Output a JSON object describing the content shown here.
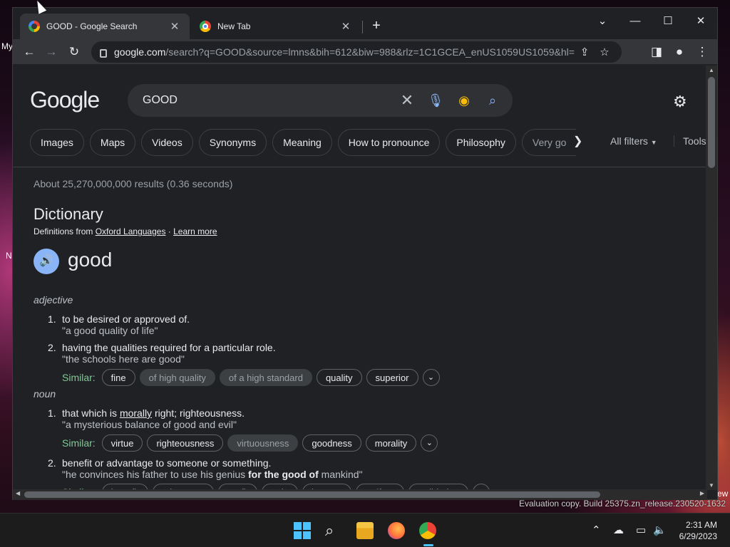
{
  "desktop": {
    "icon_label_1": "My",
    "icon_label_2": "N",
    "icon_label_3": "ew",
    "watermark": "Evaluation copy. Build 25375.zn_release.230520-1632"
  },
  "tabs": [
    {
      "title": "GOOD - Google Search"
    },
    {
      "title": "New Tab"
    }
  ],
  "toolbar": {
    "url_host": "google.com",
    "url_path": "/search?q=GOOD&source=lmns&bih=612&biw=988&rlz=1C1GCEA_enUS1059US1059&hl=en..."
  },
  "search": {
    "logo": "Google",
    "query": "GOOD"
  },
  "chips": [
    "Images",
    "Maps",
    "Videos",
    "Synonyms",
    "Meaning",
    "How to pronounce",
    "Philosophy",
    "Very go"
  ],
  "filters": {
    "all_filters": "All filters",
    "tools": "Tools"
  },
  "result_stats": "About 25,270,000,000 results (0.36 seconds)",
  "dictionary": {
    "heading": "Dictionary",
    "source_prefix": "Definitions from ",
    "source_link": "Oxford Languages",
    "source_sep": " · ",
    "learn_more": "Learn more",
    "word": "good",
    "adjective": "adjective",
    "noun": "noun",
    "similar_label": "Similar:",
    "adj_defs": [
      {
        "num": "1.",
        "text": "to be desired or approved of.",
        "example": "\"a good quality of life\""
      },
      {
        "num": "2.",
        "text": "having the qualities required for a particular role.",
        "example": "\"the schools here are good\""
      }
    ],
    "adj_similar": [
      "fine",
      "of high quality",
      "of a high standard",
      "quality",
      "superior"
    ],
    "noun_def1": {
      "num": "1.",
      "pre": "that which is ",
      "link": "morally",
      "post": " right; righteousness.",
      "example": "\"a mysterious balance of good and evil\""
    },
    "noun_similar1": [
      "virtue",
      "righteousness",
      "virtuousness",
      "goodness",
      "morality"
    ],
    "noun_def2": {
      "num": "2.",
      "text": "benefit or advantage to someone or something.",
      "ex_pre": "\"he convinces his father to use his genius ",
      "ex_bold": "for the good of",
      "ex_post": " mankind\""
    },
    "noun_similar2": [
      "benefit",
      "advantage",
      "profit",
      "gain",
      "interest",
      "welfare",
      "well-being"
    ]
  },
  "clock": {
    "time": "2:31 AM",
    "date": "6/29/2023"
  }
}
